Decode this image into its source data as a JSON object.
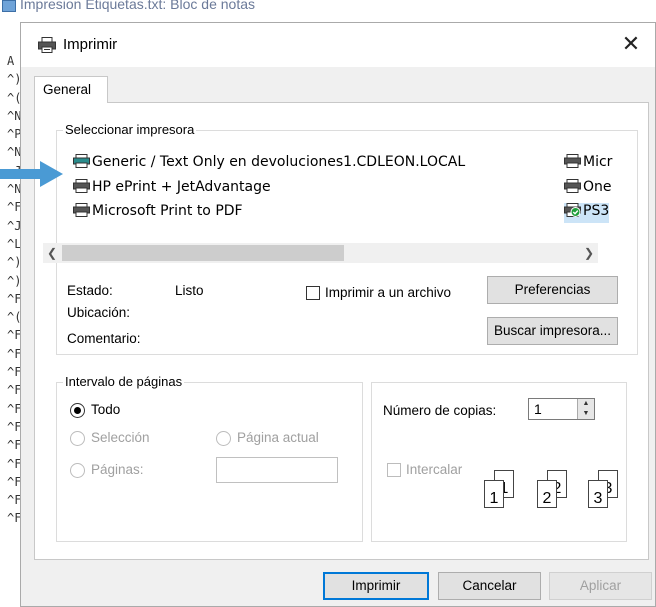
{
  "background_window": {
    "title": "Impresion Etiquetas.txt: Bloc de notas",
    "gutter": [
      "A",
      "^)",
      "^(",
      "^N",
      "^P",
      "^N",
      "~J",
      "^N",
      "^F",
      "^J",
      "^L",
      "^)",
      "^)",
      "^F",
      "^(",
      "^F",
      "^F",
      "^F",
      "^F",
      "^F",
      "^F",
      "^F",
      "^F",
      "^F",
      "^F",
      "^F"
    ]
  },
  "dialog": {
    "title": "Imprimir",
    "close_glyph": "✕",
    "tab_general": "General",
    "select_printer_label": "Seleccionar impresora",
    "printers_left": [
      "Generic / Text Only en devoluciones1.CDLEON.LOCAL",
      "HP ePrint + JetAdvantage",
      "Microsoft Print to PDF"
    ],
    "printers_right": [
      "Micr",
      "One",
      "PS3"
    ],
    "status_label": "Estado:",
    "status_value": "Listo",
    "location_label": "Ubicación:",
    "comment_label": "Comentario:",
    "print_to_file_label": "Imprimir a un archivo",
    "preferences_button": "Preferencias",
    "find_printer_button": "Buscar impresora...",
    "page_range_label": "Intervalo de páginas",
    "range_all": "Todo",
    "range_selection": "Selección",
    "range_current": "Página actual",
    "range_pages": "Páginas:",
    "copies_label": "Número de copias:",
    "copies_value": "1",
    "collate_label": "Intercalar",
    "collate_pages": [
      "1",
      "1",
      "2",
      "2",
      "3",
      "3"
    ],
    "print_button": "Imprimir",
    "cancel_button": "Cancelar",
    "apply_button": "Aplicar"
  },
  "colors": {
    "accent": "#0078d7",
    "arrow": "#4a9ad4",
    "dialog_bg": "#f0f0f0"
  }
}
